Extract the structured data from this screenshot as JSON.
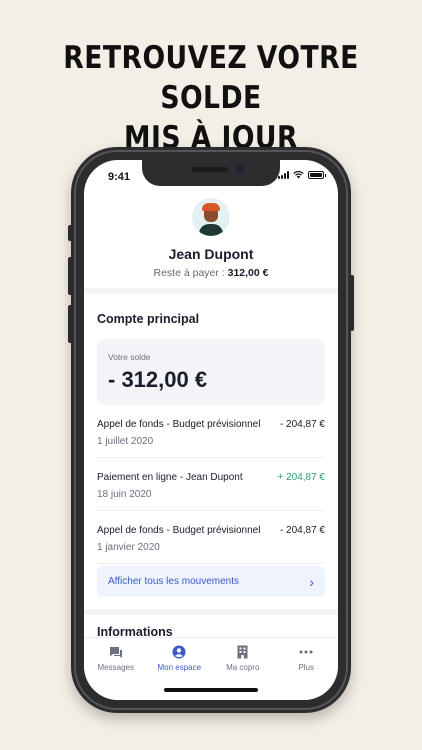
{
  "headline": {
    "line1": "RETROUVEZ VOTRE SOLDE",
    "line2": "MIS À JOUR"
  },
  "status_bar": {
    "time": "9:41"
  },
  "profile": {
    "name": "Jean Dupont",
    "due_label": "Reste à payer :",
    "due_amount": "312,00 €"
  },
  "account": {
    "title": "Compte principal",
    "balance_label": "Votre solde",
    "balance_amount": "- 312,00 €",
    "transactions": [
      {
        "title": "Appel de fonds - Budget prévisionnel",
        "date": "1 juillet 2020",
        "amount": "- 204,87 €"
      },
      {
        "title": "Paiement en ligne - Jean Dupont",
        "date": "18 juin 2020",
        "amount": "+ 204,87 €"
      },
      {
        "title": "Appel de fonds - Budget prévisionnel",
        "date": "1 janvier 2020",
        "amount": "- 204,87 €"
      }
    ],
    "view_all_label": "Afficher tous les mouvements"
  },
  "informations": {
    "title": "Informations"
  },
  "tabs": [
    {
      "label": "Messages",
      "icon": "chat-icon",
      "active": false
    },
    {
      "label": "Mon espace",
      "icon": "user-icon",
      "active": true
    },
    {
      "label": "Ma copro",
      "icon": "building-icon",
      "active": false
    },
    {
      "label": "Plus",
      "icon": "more-icon",
      "active": false
    }
  ],
  "colors": {
    "accent": "#3a5bc7",
    "positive": "#2c9c6a",
    "background": "#f4efe6"
  }
}
